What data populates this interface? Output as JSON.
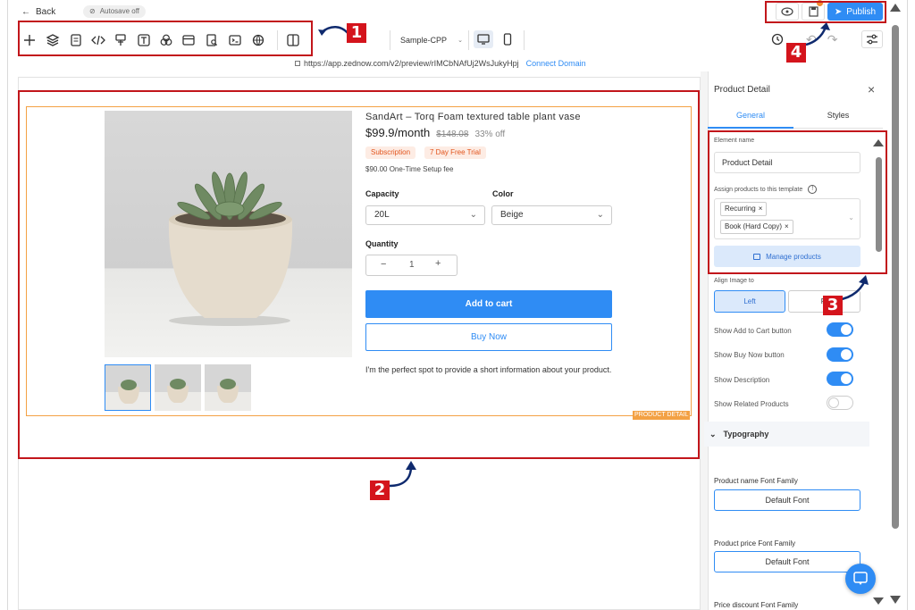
{
  "topbar": {
    "back_label": "Back",
    "autosave_label": "Autosave off",
    "publish_label": "Publish",
    "template_select": "Sample-CPP",
    "url": "https://app.zednow.com/v2/preview/rIMCbNAfUj2WsJukyHpj",
    "connect_domain_label": "Connect Domain"
  },
  "toolbar_icons": [
    "plus-icon",
    "layers-icon",
    "page-icon",
    "code-icon",
    "paint-icon",
    "text-icon",
    "blend-icon",
    "section-icon",
    "search-doc-icon",
    "terminal-icon",
    "globe-icon",
    "columns-icon"
  ],
  "annotations": {
    "n1": "1",
    "n2": "2",
    "n3": "3",
    "n4": "4"
  },
  "product": {
    "name": "SandArt – Torq Foam textured table plant vase",
    "price": "$99.9/month",
    "old_price": "$148.08",
    "discount": "33% off",
    "badges": [
      "Subscription",
      "7 Day Free Trial"
    ],
    "setup_fee": "$90.00 One-Time Setup fee",
    "capacity_label": "Capacity",
    "capacity_value": "20L",
    "color_label": "Color",
    "color_value": "Beige",
    "quantity_label": "Quantity",
    "quantity_value": "1",
    "minus": "−",
    "plus": "+",
    "add_to_cart": "Add to cart",
    "buy_now": "Buy Now",
    "description": "I'm the perfect spot to provide a short information about your product.",
    "element_tag": "PRODUCT DETAIL"
  },
  "panel": {
    "title": "Product Detail",
    "tabs": [
      "General",
      "Styles"
    ],
    "element_name_label": "Element name",
    "element_name_value": "Product Detail",
    "assign_label": "Assign products to this template",
    "assigned": [
      "Recurring",
      "Book (Hard Copy)"
    ],
    "manage_products": "Manage products",
    "align_label": "Align Image to",
    "align_left": "Left",
    "align_right": "Ri",
    "toggles": [
      {
        "label": "Show Add to Cart button",
        "on": true
      },
      {
        "label": "Show Buy Now button",
        "on": true
      },
      {
        "label": "Show Description",
        "on": true
      },
      {
        "label": "Show Related Products",
        "on": false
      }
    ],
    "typography_label": "Typography",
    "name_font_label": "Product name Font Family",
    "name_font_value": "Default Font",
    "price_font_label": "Product price Font Family",
    "price_font_value": "Default Font",
    "discount_font_label": "Price discount Font Family"
  },
  "colors": {
    "primary": "#2f8cf4",
    "red": "#c2161b",
    "orange": "#f3a144",
    "toggle_on": "#2f8cf4"
  }
}
